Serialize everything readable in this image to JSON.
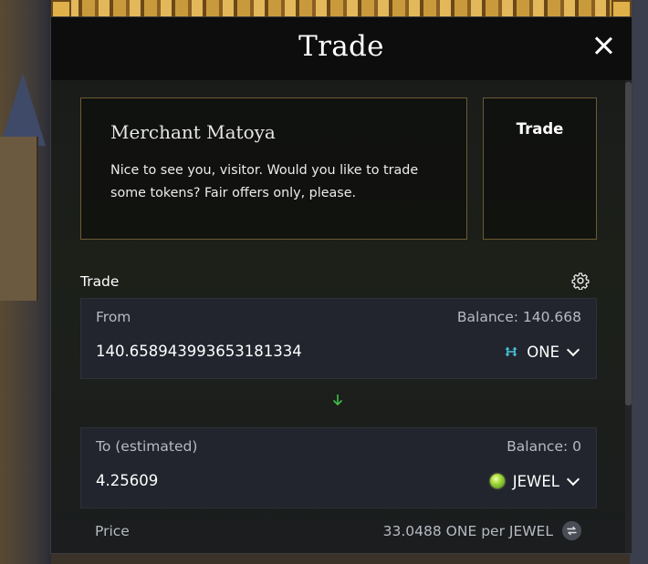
{
  "modal": {
    "title": "Trade",
    "close_icon": "close-icon"
  },
  "merchant": {
    "name": "Merchant Matoya",
    "greeting": "Nice to see you, visitor. Would you like to trade some tokens? Fair offers only, please."
  },
  "side_panel": {
    "label": "Trade"
  },
  "trade_section": {
    "label": "Trade",
    "settings_icon": "gear-icon"
  },
  "from": {
    "label": "From",
    "balance": "Balance: 140.668",
    "amount": "140.658943993653181334",
    "token": "ONE",
    "token_icon": "harmony-one-icon"
  },
  "swap": {
    "icon": "arrow-down-icon",
    "color": "#3fbf4a"
  },
  "to": {
    "label": "To (estimated)",
    "balance": "Balance: 0",
    "amount": "4.25609",
    "token": "JEWEL",
    "token_icon": "jewel-icon"
  },
  "price": {
    "label": "Price",
    "value": "33.0488 ONE per JEWEL",
    "refresh_icon": "refresh-icon"
  }
}
